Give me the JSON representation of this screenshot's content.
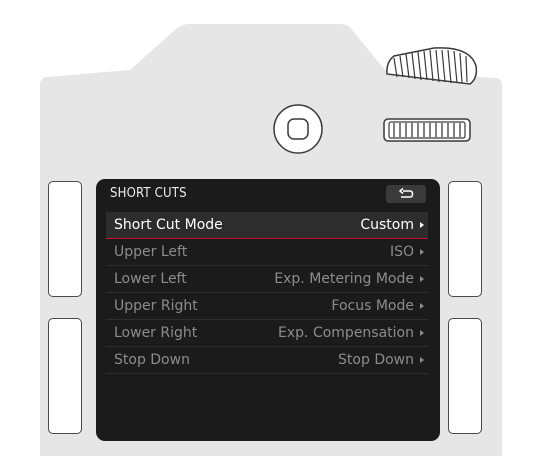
{
  "screen": {
    "title": "SHORT CUTS",
    "back_icon": "back-arrow-icon"
  },
  "menu": {
    "items": [
      {
        "label": "Short Cut Mode",
        "value": "Custom",
        "selected": true
      },
      {
        "label": "Upper Left",
        "value": "ISO",
        "selected": false
      },
      {
        "label": "Lower Left",
        "value": "Exp. Metering Mode",
        "selected": false
      },
      {
        "label": "Upper Right",
        "value": "Focus Mode",
        "selected": false
      },
      {
        "label": "Lower Right",
        "value": "Exp. Compensation",
        "selected": false
      },
      {
        "label": "Stop Down",
        "value": "Stop Down",
        "selected": false
      }
    ]
  },
  "colors": {
    "body": "#e6e6e6",
    "screen": "#1b1b1b",
    "accent": "#c8102e"
  }
}
